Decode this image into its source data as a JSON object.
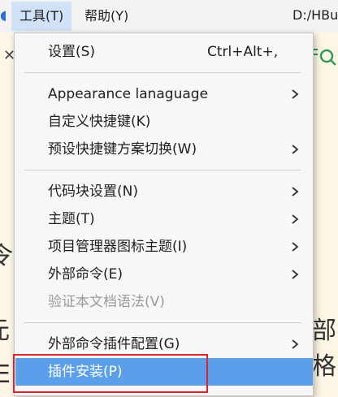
{
  "menubar": {
    "tools_label": "工具(T)",
    "help_label": "帮助(Y)",
    "path": "D:/HBu"
  },
  "tools_menu": {
    "settings": {
      "label": "设置(S)",
      "shortcut": "Ctrl+Alt+,"
    },
    "appearance_language": {
      "label": "Appearance lanaguage"
    },
    "custom_shortcuts": {
      "label": "自定义快捷键(K)"
    },
    "shortcut_scheme": {
      "label": "预设快捷键方案切换(W)"
    },
    "snippet_settings": {
      "label": "代码块设置(N)"
    },
    "theme": {
      "label": "主题(T)"
    },
    "project_icon_theme": {
      "label": "项目管理器图标主题(I)"
    },
    "external_commands": {
      "label": "外部命令(E)"
    },
    "validate_syntax": {
      "label": "验证本文档语法(V)"
    },
    "external_plugin_config": {
      "label": "外部命令插件配置(G)"
    },
    "plugin_install": {
      "label": "插件安装(P)"
    }
  },
  "background": {
    "fragment_1": "令",
    "fragment_2": "元",
    "fragment_3": "部格",
    "fragment_4": "E"
  },
  "colors": {
    "highlight": "#5b9ee9",
    "focus_outline": "#d9262b",
    "menubar_active": "#cfe2f8"
  }
}
